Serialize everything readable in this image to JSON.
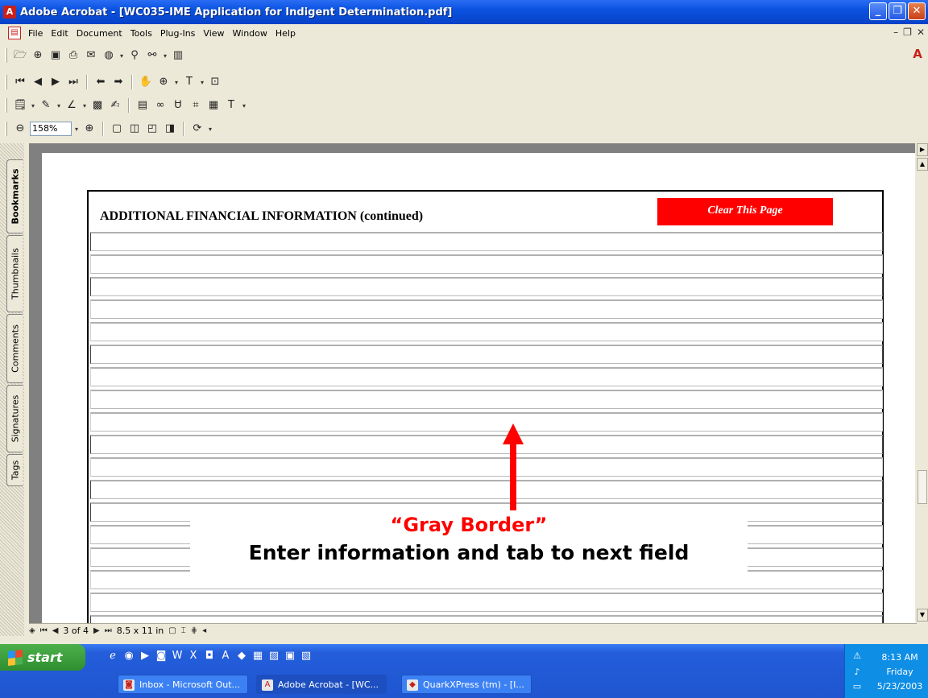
{
  "window": {
    "title": "Adobe Acrobat - [WC035-IME Application for Indigent Determination.pdf]",
    "controls": {
      "minimize": "_",
      "restore": "❐",
      "close": "✕"
    }
  },
  "menubar": {
    "items": [
      "File",
      "Edit",
      "Document",
      "Tools",
      "Plug-Ins",
      "View",
      "Window",
      "Help"
    ]
  },
  "toolbar": {
    "zoom_value": "158%"
  },
  "nav_tabs": [
    "Bookmarks",
    "Thumbnails",
    "Comments",
    "Signatures",
    "Tags"
  ],
  "document": {
    "form_title": "ADDITIONAL FINANCIAL INFORMATION (continued)",
    "clear_button": "Clear This Page",
    "annotation_title": "“Gray Border”",
    "annotation_subtitle": "Enter information and tab to next field",
    "annotation_color": "#ff0000"
  },
  "statusbar": {
    "page_indicator": "3 of 4",
    "page_size": "8.5 x 11 in"
  },
  "taskbar": {
    "start_label": "start",
    "tasks": [
      {
        "label": "Inbox - Microsoft Out...",
        "icon": "outlook-icon"
      },
      {
        "label": "Adobe Acrobat - [WC...",
        "icon": "acrobat-icon"
      },
      {
        "label": "QuarkXPress (tm) - [I...",
        "icon": "quark-icon"
      }
    ],
    "clock": {
      "time": "8:13 AM",
      "day": "Friday",
      "date": "5/23/2003"
    }
  },
  "colors": {
    "titlebar_blue": "#0a52e0",
    "start_green": "#2f8f2f",
    "clear_button_red": "#ff0000"
  }
}
